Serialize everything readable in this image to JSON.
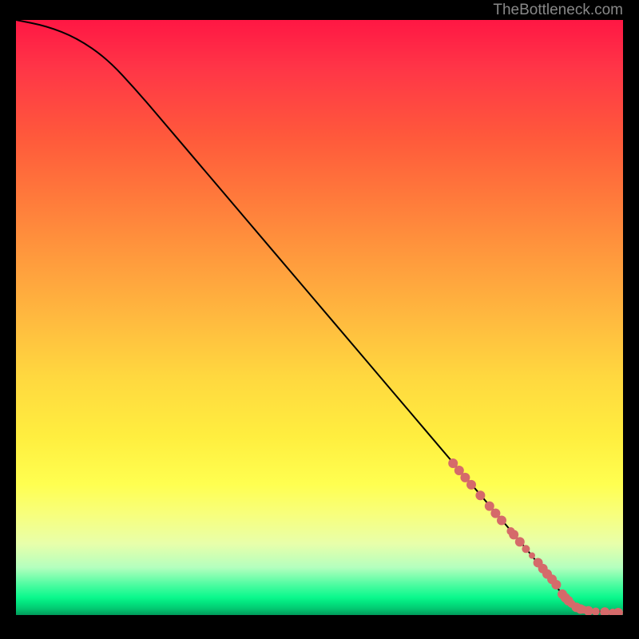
{
  "watermark": "TheBottleneck.com",
  "chart_data": {
    "type": "line",
    "title": "",
    "xlabel": "",
    "ylabel": "",
    "xlim": [
      0,
      100
    ],
    "ylim": [
      0,
      100
    ],
    "curve": {
      "name": "bottleneck-curve",
      "x": [
        0,
        5,
        10,
        15,
        20,
        25,
        30,
        35,
        40,
        45,
        50,
        55,
        60,
        65,
        70,
        75,
        80,
        85,
        88,
        90,
        92,
        95,
        100
      ],
      "y": [
        100,
        99,
        97,
        93.5,
        88,
        82,
        76,
        70,
        64,
        58,
        52,
        46,
        40,
        34,
        28,
        22,
        16,
        10,
        6,
        3.5,
        1.8,
        0.6,
        0.4
      ]
    },
    "markers": {
      "name": "highlight-points",
      "color": "#d56a6a",
      "points": [
        {
          "x": 72,
          "y": 25.5,
          "r": 6
        },
        {
          "x": 73,
          "y": 24.3,
          "r": 6
        },
        {
          "x": 74,
          "y": 23.1,
          "r": 6
        },
        {
          "x": 75,
          "y": 21.9,
          "r": 6
        },
        {
          "x": 76.5,
          "y": 20.1,
          "r": 6
        },
        {
          "x": 78,
          "y": 18.3,
          "r": 6
        },
        {
          "x": 79,
          "y": 17.1,
          "r": 6
        },
        {
          "x": 80,
          "y": 15.9,
          "r": 6
        },
        {
          "x": 81.5,
          "y": 14.1,
          "r": 5
        },
        {
          "x": 82,
          "y": 13.5,
          "r": 6
        },
        {
          "x": 83,
          "y": 12.3,
          "r": 6
        },
        {
          "x": 84,
          "y": 11.1,
          "r": 5
        },
        {
          "x": 85,
          "y": 10.0,
          "r": 4
        },
        {
          "x": 86,
          "y": 8.8,
          "r": 6
        },
        {
          "x": 86.8,
          "y": 7.8,
          "r": 6
        },
        {
          "x": 87.5,
          "y": 6.9,
          "r": 6
        },
        {
          "x": 88.3,
          "y": 6.0,
          "r": 6
        },
        {
          "x": 89,
          "y": 5.1,
          "r": 6
        },
        {
          "x": 90,
          "y": 3.5,
          "r": 6
        },
        {
          "x": 90.5,
          "y": 2.9,
          "r": 6
        },
        {
          "x": 91,
          "y": 2.4,
          "r": 6
        },
        {
          "x": 91.5,
          "y": 1.9,
          "r": 5
        },
        {
          "x": 92.3,
          "y": 1.3,
          "r": 6
        },
        {
          "x": 93,
          "y": 1.0,
          "r": 6
        },
        {
          "x": 93.5,
          "y": 0.9,
          "r": 5
        },
        {
          "x": 94.3,
          "y": 0.7,
          "r": 6
        },
        {
          "x": 95.5,
          "y": 0.6,
          "r": 5
        },
        {
          "x": 97,
          "y": 0.5,
          "r": 6
        },
        {
          "x": 98.3,
          "y": 0.4,
          "r": 5
        },
        {
          "x": 99.2,
          "y": 0.4,
          "r": 6
        }
      ]
    }
  }
}
